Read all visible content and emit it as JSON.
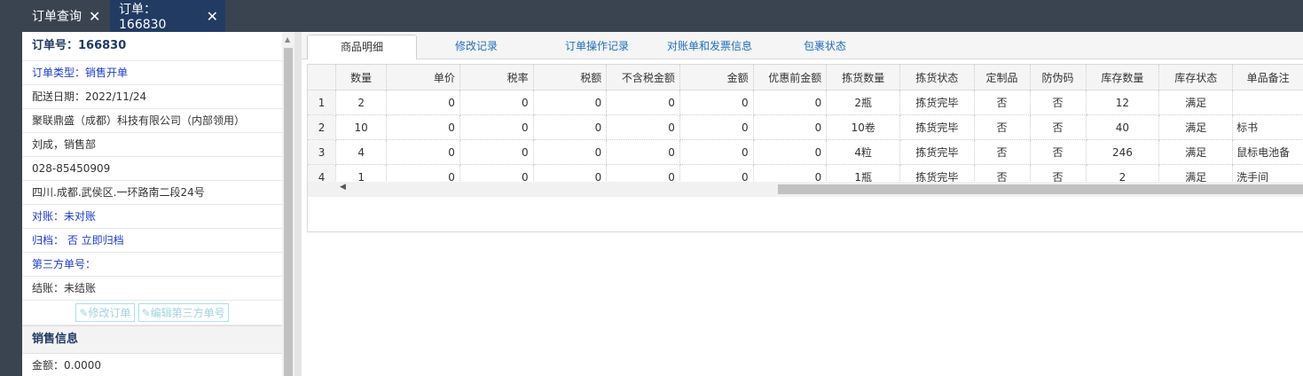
{
  "tabs": [
    {
      "label": "订单查询",
      "close": "✕"
    },
    {
      "label": "订单：166830",
      "close": "✕"
    }
  ],
  "order": {
    "number_line": "订单号：166830",
    "type_line": "订单类型：销售开单",
    "delivery_line": "配送日期：2022/11/24",
    "company_line": "聚联鼎盛（成都）科技有限公司（内部领用）",
    "person_line": "刘成，销售部",
    "phone_line": "028-85450909",
    "address_line": "四川.成都.武侯区.一环路南二段24号",
    "reconcile_line": "对账：未对账",
    "archive_line": "归档： 否 立即归档",
    "third_party_line": "第三方单号：",
    "settle_line": "结账：未结账",
    "edit_order_button": "修改订单",
    "edit_third_party_button": "编辑第三方单号"
  },
  "sales": {
    "title": "销售信息",
    "amount_line": "金额：0.0000"
  },
  "detail_tabs": [
    "商品明细",
    "修改记录",
    "订单操作记录",
    "对账单和发票信息",
    "包裹状态"
  ],
  "table": {
    "columns": [
      "",
      "数量",
      "单价",
      "税率",
      "税额",
      "不含税金额",
      "金额",
      "优惠前金额",
      "拣货数量",
      "拣货状态",
      "定制品",
      "防伪码",
      "库存数量",
      "库存状态",
      "单品备注"
    ],
    "rows": [
      [
        "1",
        "2",
        "0",
        "0",
        "0",
        "0",
        "0",
        "0",
        "2瓶",
        "拣货完毕",
        "否",
        "否",
        "12",
        "满足",
        ""
      ],
      [
        "2",
        "10",
        "0",
        "0",
        "0",
        "0",
        "0",
        "0",
        "10卷",
        "拣货完毕",
        "否",
        "否",
        "40",
        "满足",
        "标书"
      ],
      [
        "3",
        "4",
        "0",
        "0",
        "0",
        "0",
        "0",
        "0",
        "4粒",
        "拣货完毕",
        "否",
        "否",
        "246",
        "满足",
        "鼠标电池备"
      ],
      [
        "4",
        "1",
        "0",
        "0",
        "0",
        "0",
        "0",
        "0",
        "1瓶",
        "拣货完毕",
        "否",
        "否",
        "2",
        "满足",
        "洗手间"
      ]
    ]
  }
}
